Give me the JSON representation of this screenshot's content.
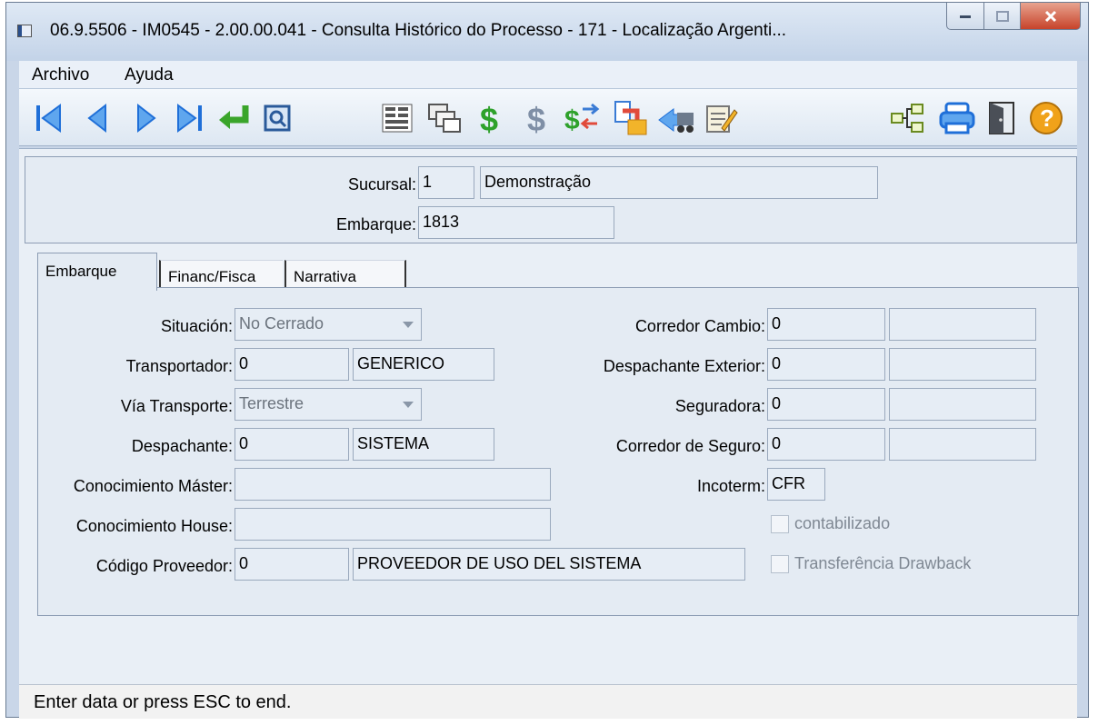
{
  "window": {
    "title": "06.9.5506 - IM0545 - 2.00.00.041 - Consulta Histórico do Processo - 171 - Localização Argenti..."
  },
  "menu": {
    "items": [
      "Archivo",
      "Ayuda"
    ]
  },
  "toolbar": {
    "left_icons": [
      "first-record-icon",
      "previous-record-icon",
      "next-record-icon",
      "last-record-icon",
      "return-icon",
      "view-icon"
    ],
    "middle_icons": [
      "list-icon",
      "windows-icon",
      "green-dollar-icon",
      "gray-dollar-icon",
      "dollar-transfer-icon",
      "export-icon",
      "transport-icon",
      "notes-icon"
    ],
    "right_icons": [
      "tree-icon",
      "print-icon",
      "exit-door-icon",
      "help-icon"
    ]
  },
  "header": {
    "sucursal_label": "Sucursal:",
    "sucursal_code": "1",
    "sucursal_name": "Demonstração",
    "embarque_label": "Embarque:",
    "embarque_value": "1813"
  },
  "tabs": [
    "Embarque",
    "Financ/Fisca",
    "Narrativa"
  ],
  "form": {
    "situacion_label": "Situación:",
    "situacion_value": "No Cerrado",
    "transportador_label": "Transportador:",
    "transportador_code": "0",
    "transportador_name": "GENERICO",
    "via_label": "Vía Transporte:",
    "via_value": "Terrestre",
    "despachante_label": "Despachante:",
    "despachante_code": "0",
    "despachante_name": "SISTEMA",
    "con_master_label": "Conocimiento Máster:",
    "con_master_value": "",
    "con_house_label": "Conocimiento House:",
    "con_house_value": "",
    "proveedor_label": "Código Proveedor:",
    "proveedor_code": "0",
    "proveedor_name": "PROVEEDOR DE USO DEL SISTEMA",
    "corredor_cambio_label": "Corredor Cambio:",
    "corredor_cambio_code": "0",
    "desp_ext_label": "Despachante Exterior:",
    "desp_ext_code": "0",
    "seguradora_label": "Seguradora:",
    "seguradora_code": "0",
    "corredor_seguro_label": "Corredor de Seguro:",
    "corredor_seguro_code": "0",
    "incoterm_label": "Incoterm:",
    "incoterm_value": "CFR",
    "contabilizado_label": "contabilizado",
    "drawback_label": "Transferência Drawback"
  },
  "status": {
    "text": "Enter data or press ESC to end."
  },
  "colors": {
    "accent_blue": "#1f6fd8",
    "green": "#3aa52b",
    "help_orange": "#f0a21a"
  }
}
